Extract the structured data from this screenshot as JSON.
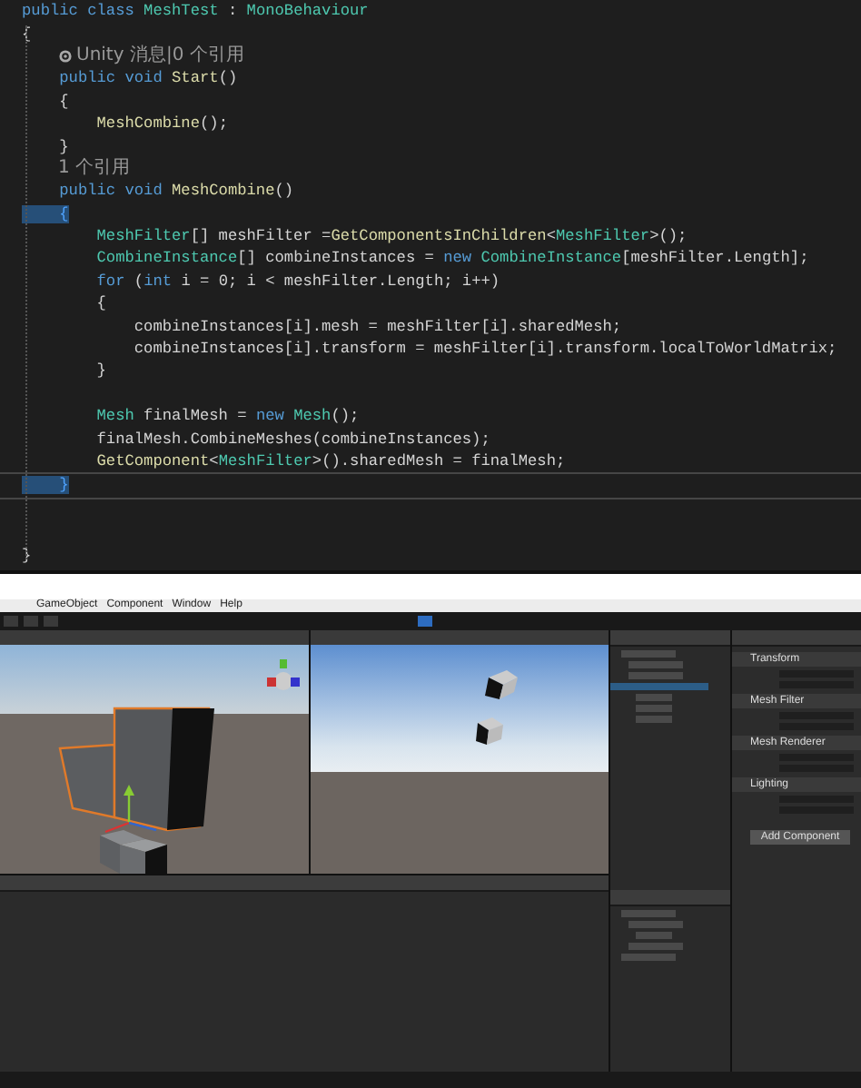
{
  "code_editor": {
    "lines": [
      {
        "kind": "code",
        "current": false,
        "tokens": [
          {
            "t": "public class ",
            "kind": "kw"
          },
          {
            "t": "MeshTest",
            "kind": "type"
          },
          {
            "t": " : ",
            "kind": "plain"
          },
          {
            "t": "MonoBehaviour",
            "kind": "type"
          }
        ]
      },
      {
        "kind": "code",
        "current": false,
        "tokens": [
          {
            "t": "{",
            "kind": "plain"
          }
        ]
      },
      {
        "kind": "hint",
        "current": false,
        "icon": true,
        "text": "Unity 消息|0 个引用"
      },
      {
        "kind": "code",
        "current": false,
        "tokens": [
          {
            "t": "    public void ",
            "kind": "kw"
          },
          {
            "t": "Start",
            "kind": "method"
          },
          {
            "t": "()",
            "kind": "plain"
          }
        ]
      },
      {
        "kind": "code",
        "current": false,
        "tokens": [
          {
            "t": "    {",
            "kind": "plain"
          }
        ]
      },
      {
        "kind": "code",
        "current": false,
        "tokens": [
          {
            "t": "        MeshCombine",
            "kind": "method"
          },
          {
            "t": "();",
            "kind": "plain"
          }
        ]
      },
      {
        "kind": "code",
        "current": false,
        "tokens": [
          {
            "t": "    }",
            "kind": "plain"
          }
        ]
      },
      {
        "kind": "hint",
        "current": false,
        "icon": false,
        "text": "1 个引用"
      },
      {
        "kind": "code",
        "current": false,
        "tokens": [
          {
            "t": "    public void ",
            "kind": "kw"
          },
          {
            "t": "MeshCombine",
            "kind": "method"
          },
          {
            "t": "()",
            "kind": "plain"
          }
        ]
      },
      {
        "kind": "code",
        "current": false,
        "tokens": [
          {
            "t": "    {",
            "kind": "match"
          }
        ]
      },
      {
        "kind": "code",
        "current": false,
        "tokens": [
          {
            "t": "        MeshFilter",
            "kind": "type"
          },
          {
            "t": "[] meshFilter =",
            "kind": "plain"
          },
          {
            "t": "GetComponentsInChildren",
            "kind": "method"
          },
          {
            "t": "<",
            "kind": "plain"
          },
          {
            "t": "MeshFilter",
            "kind": "type"
          },
          {
            "t": ">();",
            "kind": "plain"
          }
        ]
      },
      {
        "kind": "code",
        "current": false,
        "tokens": [
          {
            "t": "        CombineInstance",
            "kind": "type"
          },
          {
            "t": "[] combineInstances = ",
            "kind": "plain"
          },
          {
            "t": "new ",
            "kind": "kw"
          },
          {
            "t": "CombineInstance",
            "kind": "type"
          },
          {
            "t": "[meshFilter.Length];",
            "kind": "plain"
          }
        ]
      },
      {
        "kind": "code",
        "current": false,
        "tokens": [
          {
            "t": "        for ",
            "kind": "kw"
          },
          {
            "t": "(",
            "kind": "plain"
          },
          {
            "t": "int",
            "kind": "kw"
          },
          {
            "t": " i = 0; i < meshFilter.Length; i++)",
            "kind": "plain"
          }
        ]
      },
      {
        "kind": "code",
        "current": false,
        "tokens": [
          {
            "t": "        {",
            "kind": "plain"
          }
        ]
      },
      {
        "kind": "code",
        "current": false,
        "tokens": [
          {
            "t": "            combineInstances[i].mesh = meshFilter[i].sharedMesh;",
            "kind": "plain"
          }
        ]
      },
      {
        "kind": "code",
        "current": false,
        "tokens": [
          {
            "t": "            combineInstances[i].transform = meshFilter[i].transform.localToWorldMatrix;",
            "kind": "plain"
          }
        ]
      },
      {
        "kind": "code",
        "current": false,
        "tokens": [
          {
            "t": "        }",
            "kind": "plain"
          }
        ]
      },
      {
        "kind": "blank"
      },
      {
        "kind": "code",
        "current": false,
        "tokens": [
          {
            "t": "        Mesh",
            "kind": "type"
          },
          {
            "t": " finalMesh = ",
            "kind": "plain"
          },
          {
            "t": "new ",
            "kind": "kw"
          },
          {
            "t": "Mesh",
            "kind": "type"
          },
          {
            "t": "();",
            "kind": "plain"
          }
        ]
      },
      {
        "kind": "code",
        "current": false,
        "tokens": [
          {
            "t": "        finalMesh.CombineMeshes(combineInstances);",
            "kind": "plain"
          }
        ]
      },
      {
        "kind": "code",
        "current": false,
        "tokens": [
          {
            "t": "        GetComponent",
            "kind": "method"
          },
          {
            "t": "<",
            "kind": "plain"
          },
          {
            "t": "MeshFilter",
            "kind": "type"
          },
          {
            "t": ">().sharedMesh = finalMesh;",
            "kind": "plain"
          }
        ]
      },
      {
        "kind": "code",
        "current": true,
        "tokens": [
          {
            "t": "    }",
            "kind": "match"
          }
        ]
      },
      {
        "kind": "blank"
      },
      {
        "kind": "blank"
      },
      {
        "kind": "code",
        "current": false,
        "tokens": [
          {
            "t": "}",
            "kind": "plain"
          }
        ]
      }
    ]
  },
  "unity_editor": {
    "menu": [
      "GameObject",
      "Component",
      "Window",
      "Help"
    ],
    "hierarchy": {
      "rows": [
        {
          "selected": false
        },
        {
          "selected": false
        },
        {
          "selected": false
        },
        {
          "selected": true
        },
        {
          "selected": false
        },
        {
          "selected": false
        },
        {
          "selected": false
        }
      ]
    },
    "inspector": {
      "components": [
        "Transform",
        "Mesh Filter",
        "Mesh Renderer",
        "Lighting"
      ],
      "add_button": "Add Component"
    }
  }
}
